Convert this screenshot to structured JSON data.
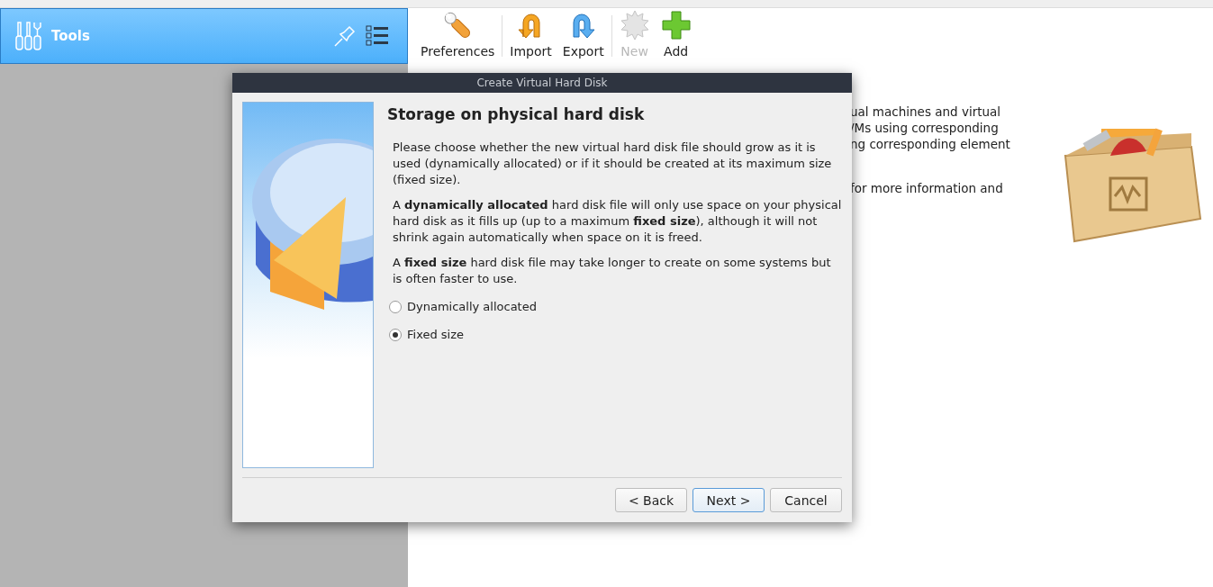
{
  "sidebar": {
    "title": "Tools"
  },
  "toolbar": {
    "groups": [
      [
        {
          "label": "Preferences",
          "disabled": false
        }
      ],
      [
        {
          "label": "Import",
          "disabled": false
        },
        {
          "label": "Export",
          "disabled": false
        }
      ],
      [
        {
          "label": "New",
          "disabled": true
        },
        {
          "label": "Add",
          "disabled": false
        }
      ]
    ]
  },
  "welcome": {
    "paragraphs": [
      [
        "ual machines and virtual",
        "/Ms using corresponding",
        "ng corresponding element"
      ],
      [
        "for more information and"
      ]
    ]
  },
  "dialog": {
    "title": "Create Virtual Hard Disk",
    "heading": "Storage on physical hard disk",
    "paragraphs": [
      "Please choose whether the new virtual hard disk file should grow as it is used (dynamically allocated) or if it should be created at its maximum size (fixed size).",
      "A **dynamically allocated** hard disk file will only use space on your physical hard disk as it fills up (up to a maximum **fixed size**), although it will not shrink again automatically when space on it is freed.",
      "A **fixed size** hard disk file may take longer to create on some systems but is often faster to use."
    ],
    "options": [
      {
        "label": "Dynamically allocated",
        "selected": false
      },
      {
        "label": "Fixed size",
        "selected": true
      }
    ],
    "buttons": [
      {
        "label": "< Back",
        "default": false
      },
      {
        "label": "Next >",
        "default": true
      },
      {
        "label": "Cancel",
        "default": false
      }
    ]
  }
}
